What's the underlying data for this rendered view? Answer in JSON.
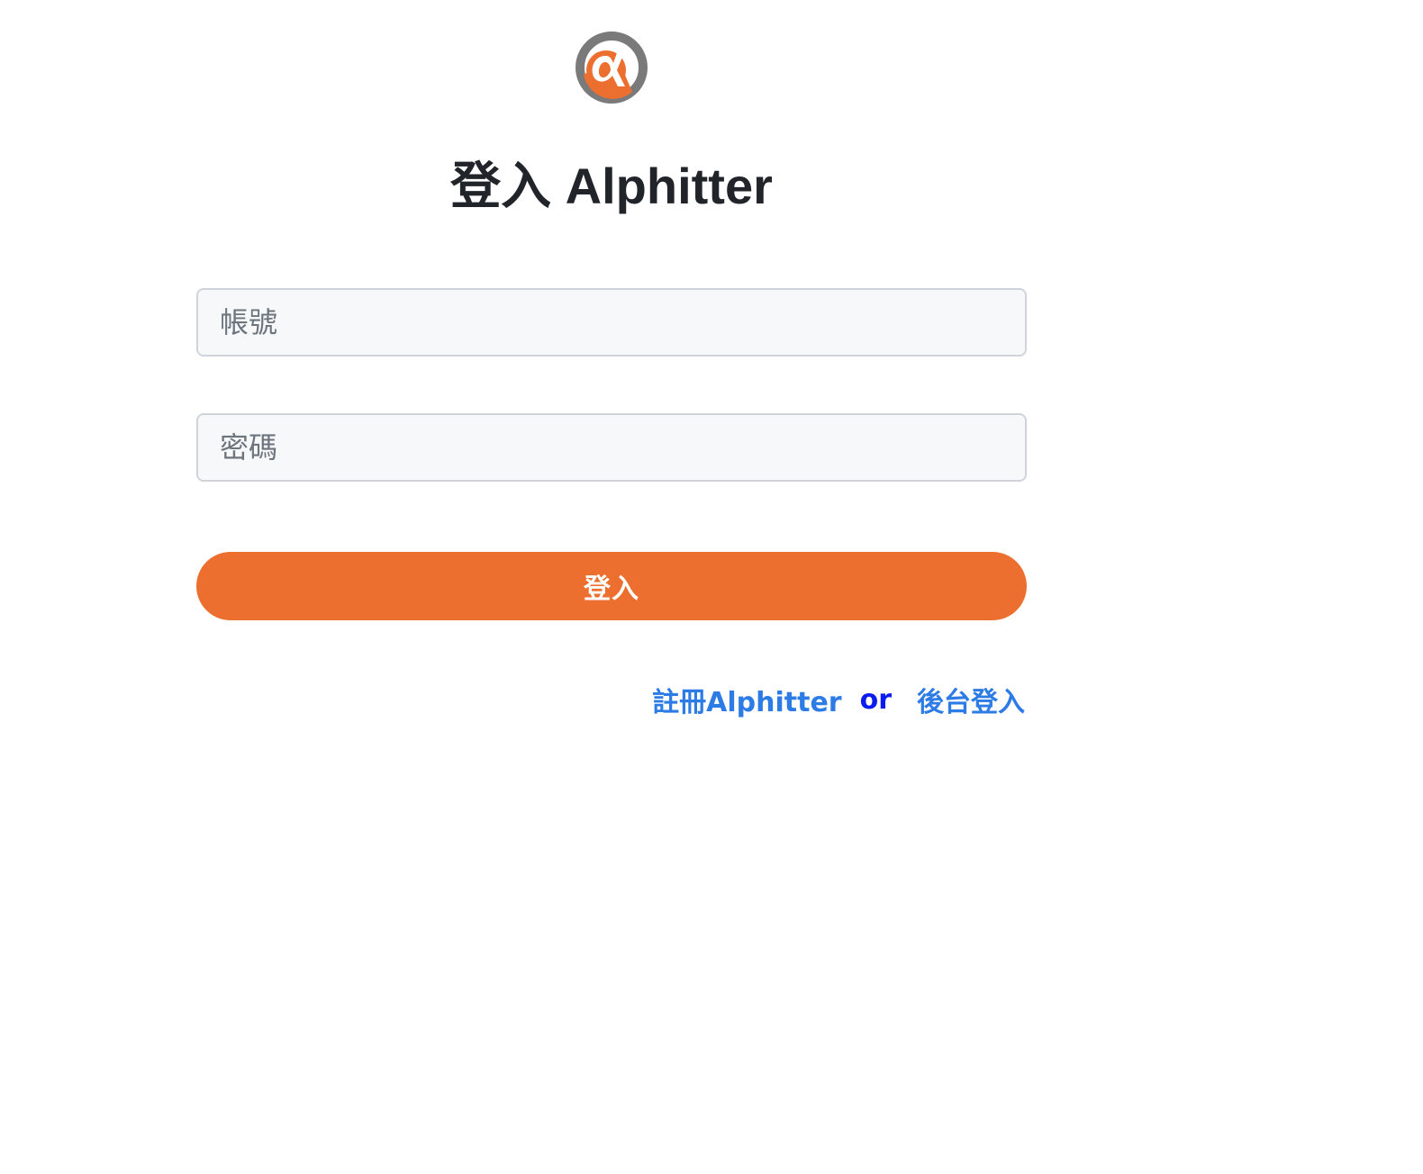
{
  "brand": {
    "logo_icon": "alpha-logo-icon",
    "primary_color": "#ec6f2f",
    "logo_gray": "#7a7a7a"
  },
  "header": {
    "title": "登入 Alphitter"
  },
  "form": {
    "account_placeholder": "帳號",
    "account_value": "",
    "password_placeholder": "密碼",
    "password_value": "",
    "submit_label": "登入"
  },
  "links": {
    "register_label": "註冊Alphitter",
    "separator": "or",
    "admin_login_label": "後台登入",
    "link_color": "#2d7be5",
    "separator_color": "#0a1cf0"
  }
}
